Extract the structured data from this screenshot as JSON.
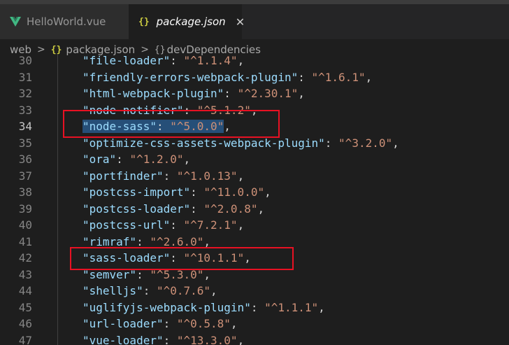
{
  "tabs": [
    {
      "label": "HelloWorld.vue",
      "icon": "vue-icon",
      "active": false
    },
    {
      "label": "package.json",
      "icon": "json-braces-icon",
      "active": true
    }
  ],
  "breadcrumb": {
    "folder": "web",
    "file": "package.json",
    "symbol": "devDependencies",
    "separator": ">"
  },
  "editor": {
    "current_line": 34,
    "selected_text": "\"node-sass\": \"^5.0.0\"",
    "lines": [
      {
        "num": "30",
        "key": "\"file-loader\"",
        "value": "\"^1.1.4\""
      },
      {
        "num": "31",
        "key": "\"friendly-errors-webpack-plugin\"",
        "value": "\"^1.6.1\""
      },
      {
        "num": "32",
        "key": "\"html-webpack-plugin\"",
        "value": "\"^2.30.1\""
      },
      {
        "num": "33",
        "key": "\"node-notifier\"",
        "value": "\"^5.1.2\""
      },
      {
        "num": "34",
        "key": "\"node-sass\"",
        "value": "\"^5.0.0\""
      },
      {
        "num": "35",
        "key": "\"optimize-css-assets-webpack-plugin\"",
        "value": "\"^3.2.0\""
      },
      {
        "num": "36",
        "key": "\"ora\"",
        "value": "\"^1.2.0\""
      },
      {
        "num": "37",
        "key": "\"portfinder\"",
        "value": "\"^1.0.13\""
      },
      {
        "num": "38",
        "key": "\"postcss-import\"",
        "value": "\"^11.0.0\""
      },
      {
        "num": "39",
        "key": "\"postcss-loader\"",
        "value": "\"^2.0.8\""
      },
      {
        "num": "40",
        "key": "\"postcss-url\"",
        "value": "\"^7.2.1\""
      },
      {
        "num": "41",
        "key": "\"rimraf\"",
        "value": "\"^2.6.0\""
      },
      {
        "num": "42",
        "key": "\"sass-loader\"",
        "value": "\"^10.1.1\""
      },
      {
        "num": "43",
        "key": "\"semver\"",
        "value": "\"^5.3.0\""
      },
      {
        "num": "44",
        "key": "\"shelljs\"",
        "value": "\"^0.7.6\""
      },
      {
        "num": "45",
        "key": "\"uglifyjs-webpack-plugin\"",
        "value": "\"^1.1.1\""
      },
      {
        "num": "46",
        "key": "\"url-loader\"",
        "value": "\"^0.5.8\""
      },
      {
        "num": "47",
        "key": "\"vue-loader\"",
        "value": "\"^13.3.0\""
      }
    ]
  },
  "colors": {
    "background": "#1e1e1e",
    "key": "#9cdcfe",
    "string": "#ce9178",
    "selection": "#264f78",
    "annotation_box": "#e81123"
  }
}
